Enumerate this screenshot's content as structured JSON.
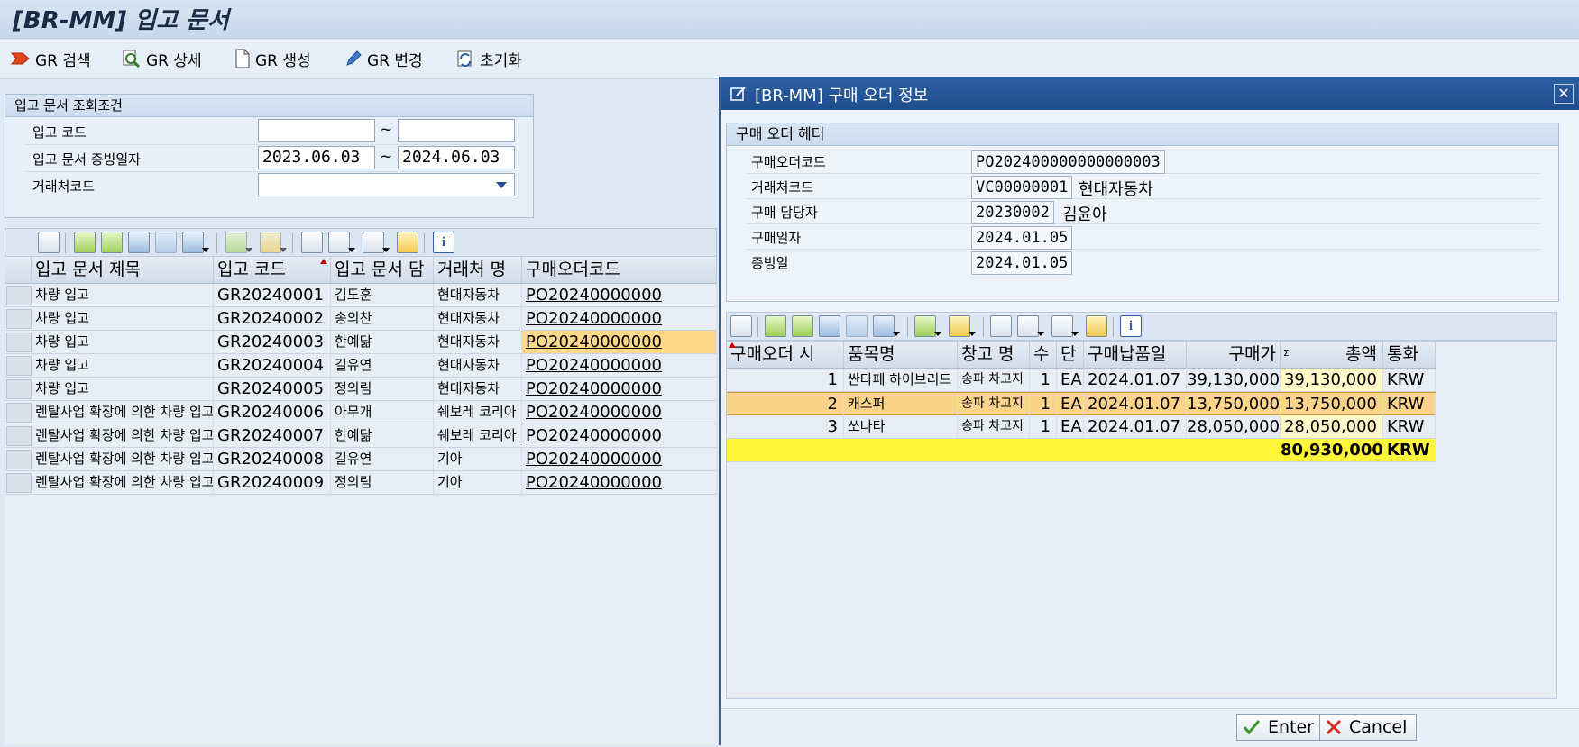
{
  "app": {
    "title": "[BR-MM] 입고 문서"
  },
  "toolbar": {
    "gr_search": "GR 검색",
    "gr_detail": "GR 상세",
    "gr_create": "GR 생성",
    "gr_change": "GR 변경",
    "reset": "초기화"
  },
  "query": {
    "panel_title": "입고 문서 조회조건",
    "code_label": "입고 코드",
    "code_from": "",
    "code_to": "",
    "tilde": "~",
    "date_label": "입고 문서 증빙일자",
    "date_from": "2023.06.03",
    "date_to": "2024.06.03",
    "vendor_label": "거래처코드",
    "vendor_value": ""
  },
  "left_grid": {
    "headers": [
      "입고 문서 제목",
      "입고 코드",
      "입고 문서 담",
      "거래처 명",
      "구매오더코드"
    ],
    "rows": [
      {
        "title": "차량 입고",
        "code": "GR20240001",
        "owner": "김도훈",
        "vendor": "현대자동차",
        "po": "PO20240000000"
      },
      {
        "title": "차량 입고",
        "code": "GR20240002",
        "owner": "송의찬",
        "vendor": "현대자동차",
        "po": "PO20240000000"
      },
      {
        "title": "차량 입고",
        "code": "GR20240003",
        "owner": "한예닮",
        "vendor": "현대자동차",
        "po": "PO20240000000"
      },
      {
        "title": "차량 입고",
        "code": "GR20240004",
        "owner": "길유연",
        "vendor": "현대자동차",
        "po": "PO20240000000"
      },
      {
        "title": "차량 입고",
        "code": "GR20240005",
        "owner": "정의림",
        "vendor": "현대자동차",
        "po": "PO20240000000"
      },
      {
        "title": "렌탈사업 확장에 의한 차량 입고",
        "code": "GR20240006",
        "owner": "아무개",
        "vendor": "쉐보레 코리아",
        "po": "PO20240000000"
      },
      {
        "title": "렌탈사업 확장에 의한 차량 입고",
        "code": "GR20240007",
        "owner": "한예닮",
        "vendor": "쉐보레 코리아",
        "po": "PO20240000000"
      },
      {
        "title": "렌탈사업 확장에 의한 차량 입고",
        "code": "GR20240008",
        "owner": "길유연",
        "vendor": "기아",
        "po": "PO20240000000"
      },
      {
        "title": "렌탈사업 확장에 의한 차량 입고",
        "code": "GR20240009",
        "owner": "정의림",
        "vendor": "기아",
        "po": "PO20240000000"
      }
    ]
  },
  "dialog": {
    "title": "[BR-MM] 구매 오더 정보",
    "close_glyph": "✕",
    "header_panel_title": "구매 오더 헤더",
    "po_code_label": "구매오더코드",
    "po_code": "PO202400000000000003",
    "vendor_label": "거래처코드",
    "vendor_code": "VC00000001",
    "vendor_name": "현대자동차",
    "buyer_label": "구매 담당자",
    "buyer_code": "20230002",
    "buyer_name": "김윤아",
    "purchase_date_label": "구매일자",
    "purchase_date": "2024.01.05",
    "evidence_date_label": "증빙일",
    "evidence_date": "2024.01.05",
    "grid_headers": [
      "구매오더 시",
      "품목명",
      "창고 명",
      "수",
      "단",
      "구매납품일",
      "구매가",
      "총액",
      "통화"
    ],
    "items": [
      {
        "seq": "1",
        "name": "싼타페 하이브리드",
        "wh": "송파 차고지",
        "qty": "1",
        "unit": "EA",
        "date": "2024.01.07",
        "price": "39,130,000",
        "total": "39,130,000",
        "cur": "KRW"
      },
      {
        "seq": "2",
        "name": "캐스퍼",
        "wh": "송파 차고지",
        "qty": "1",
        "unit": "EA",
        "date": "2024.01.07",
        "price": "13,750,000",
        "total": "13,750,000",
        "cur": "KRW"
      },
      {
        "seq": "3",
        "name": "쏘나타",
        "wh": "송파 차고지",
        "qty": "1",
        "unit": "EA",
        "date": "2024.01.07",
        "price": "28,050,000",
        "total": "28,050,000",
        "cur": "KRW"
      }
    ],
    "sum_total": "80,930,000",
    "sum_currency": "KRW",
    "sigma": "Σ",
    "enter_label": "Enter",
    "cancel_label": "Cancel"
  },
  "colors": {
    "title_blue": "#1f4d8c",
    "selected_row": "#fbd38a",
    "sum_row": "#fff53a",
    "highlight_cell": "#ffd98a"
  }
}
